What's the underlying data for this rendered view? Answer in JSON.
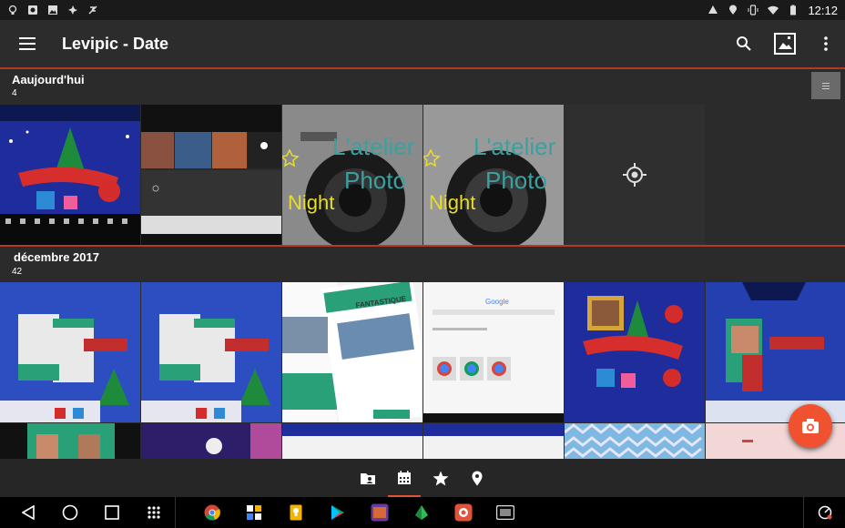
{
  "status": {
    "time": "12:12"
  },
  "appbar": {
    "title": "Levipic - Date"
  },
  "sections": [
    {
      "title": "Aaujourd'hui",
      "count": "4"
    },
    {
      "title": "décembre 2017",
      "count": "42"
    }
  ],
  "tiles": {
    "t4_text1": "L'atelier",
    "t4_text2": "Photo",
    "t4_text3": "Night",
    "q_badge": "FANTASTIQUE",
    "google_label": "Google"
  },
  "colors": {
    "accent": "#f0512e",
    "divider": "#b33a25"
  }
}
